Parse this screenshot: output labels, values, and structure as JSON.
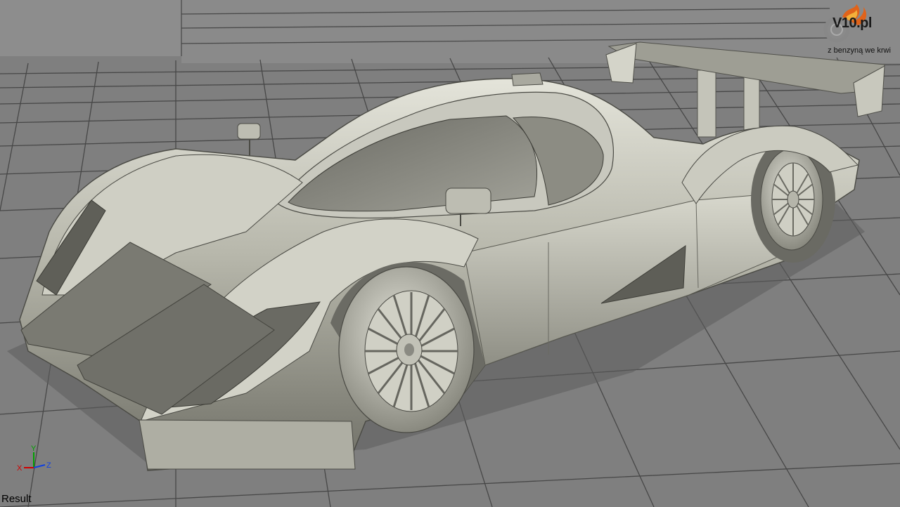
{
  "viewport": {
    "label": "Result",
    "background_color": "#7d7d7d",
    "grid_color": "#3a3a3a",
    "model_color": "#b9b9ad"
  },
  "logo": {
    "text": "V10.pl",
    "tagline": "z benzyną we krwi",
    "flame_color": "#e0631a"
  },
  "axis": {
    "x": "X",
    "y": "Y",
    "z": "Z",
    "x_color": "#d00000",
    "y_color": "#00a000",
    "z_color": "#1040e0"
  }
}
